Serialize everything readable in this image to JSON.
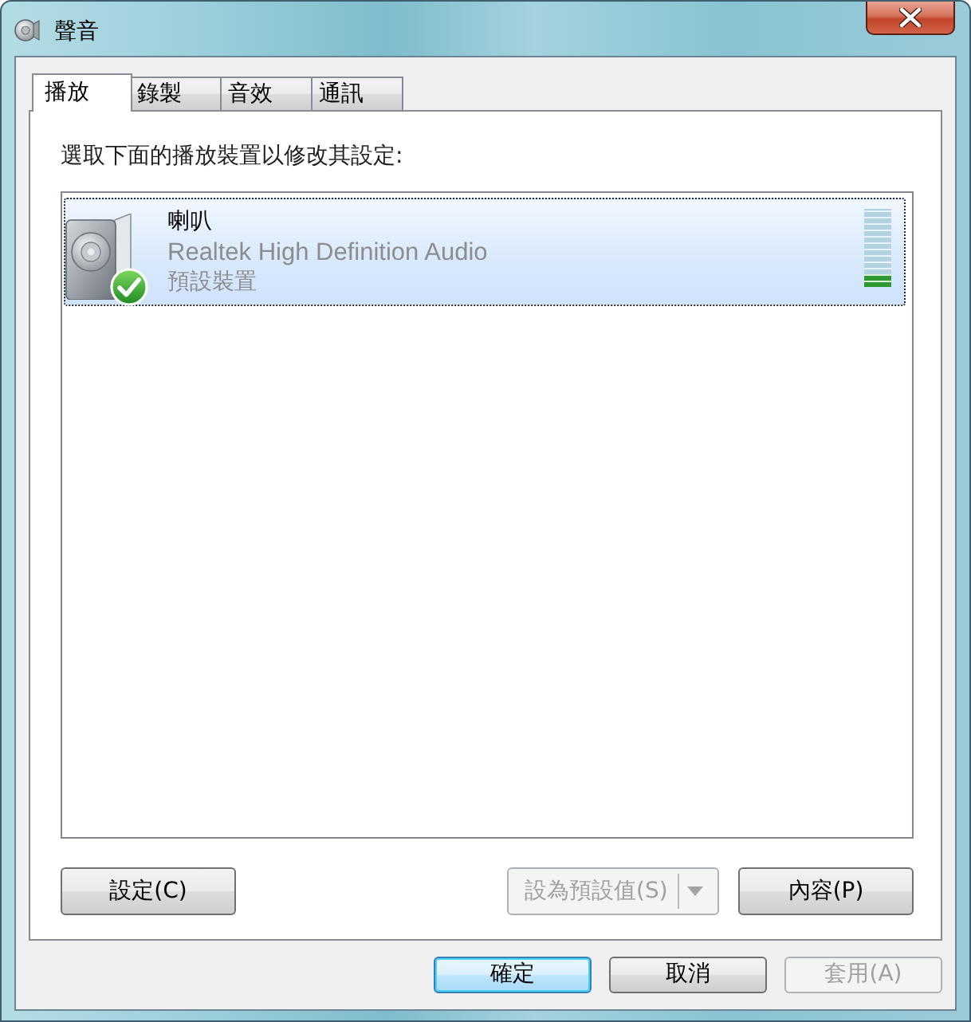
{
  "window": {
    "title": "聲音"
  },
  "tabs": [
    {
      "label": "播放",
      "selected": true
    },
    {
      "label": "錄製",
      "selected": false
    },
    {
      "label": "音效",
      "selected": false
    },
    {
      "label": "通訊",
      "selected": false
    }
  ],
  "instruction": "選取下面的播放裝置以修改其設定:",
  "devices": [
    {
      "name": "喇叭",
      "description": "Realtek High Definition Audio",
      "status": "預設裝置",
      "selected": true,
      "is_default": true,
      "level": 0.17
    }
  ],
  "panel_buttons": [
    {
      "kind": "button",
      "label": "設定(C)",
      "disabled": false
    },
    {
      "kind": "split",
      "label": "設為預設值(S)",
      "disabled": true
    },
    {
      "kind": "button",
      "label": "內容(P)",
      "disabled": false
    }
  ],
  "dialog_buttons": [
    {
      "label": "確定",
      "default": true,
      "disabled": false
    },
    {
      "label": "取消",
      "default": false,
      "disabled": false
    },
    {
      "label": "套用(A)",
      "default": false,
      "disabled": true
    }
  ]
}
